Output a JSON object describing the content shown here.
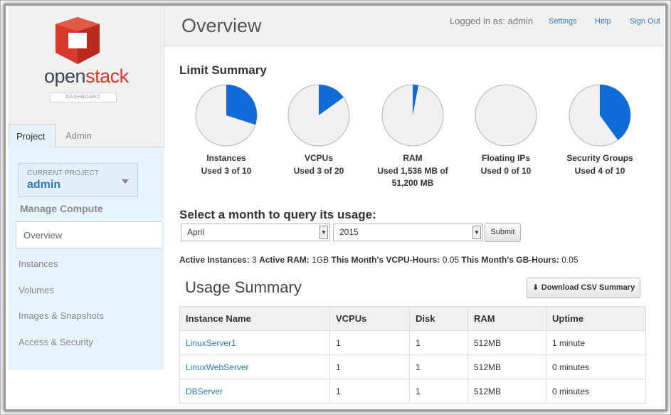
{
  "brand": {
    "word_open": "open",
    "word_stack": "stack",
    "badge": "DASHBOARD"
  },
  "colors": {
    "accent": "#2b7bb9",
    "pie_fill": "#0e6bd8",
    "pie_bg": "#f1f1f1",
    "logo_red": "#d53a2b"
  },
  "sidebar": {
    "tabs": [
      {
        "label": "Project"
      },
      {
        "label": "Admin"
      }
    ],
    "project_caption": "CURRENT PROJECT",
    "project_name": "admin",
    "section_heading": "Manage Compute",
    "items": [
      {
        "label": "Overview"
      },
      {
        "label": "Instances"
      },
      {
        "label": "Volumes"
      },
      {
        "label": "Images & Snapshots"
      },
      {
        "label": "Access & Security"
      }
    ]
  },
  "header": {
    "title": "Overview",
    "logged_in": "Logged in as: admin",
    "links": [
      {
        "label": "Settings"
      },
      {
        "label": "Help"
      },
      {
        "label": "Sign Out"
      }
    ]
  },
  "limit_summary": {
    "heading": "Limit Summary",
    "pies": [
      {
        "name": "Instances",
        "usage_line1": "Used 3 of 10",
        "usage_line2": "",
        "used": 3,
        "limit": 10
      },
      {
        "name": "VCPUs",
        "usage_line1": "Used 3 of 20",
        "usage_line2": "",
        "used": 3,
        "limit": 20
      },
      {
        "name": "RAM",
        "usage_line1": "Used 1,536 MB of",
        "usage_line2": "51,200 MB",
        "used": 1536,
        "limit": 51200
      },
      {
        "name": "Floating IPs",
        "usage_line1": "Used 0 of 10",
        "usage_line2": "",
        "used": 0,
        "limit": 10
      },
      {
        "name": "Security Groups",
        "usage_line1": "Used 4 of 10",
        "usage_line2": "",
        "used": 4,
        "limit": 10
      }
    ]
  },
  "query": {
    "label": "Select a month to query its usage:",
    "month_value": "April",
    "year_value": "2015",
    "submit_label": "Submit"
  },
  "stats": {
    "active_instances_label": "Active Instances:",
    "active_instances_value": "3",
    "active_ram_label": "Active RAM:",
    "active_ram_value": "1GB",
    "vcpu_hours_label": "This Month's VCPU-Hours:",
    "vcpu_hours_value": "0.05",
    "gb_hours_label": "This Month's GB-Hours:",
    "gb_hours_value": "0.05"
  },
  "usage": {
    "title": "Usage Summary",
    "download_label": "Download CSV Summary",
    "columns": [
      "Instance Name",
      "VCPUs",
      "Disk",
      "RAM",
      "Uptime"
    ],
    "rows": [
      [
        "LinuxServer1",
        "1",
        "1",
        "512MB",
        "1 minute"
      ],
      [
        "LinuxWebServer",
        "1",
        "1",
        "512MB",
        "0 minutes"
      ],
      [
        "DBServer",
        "1",
        "1",
        "512MB",
        "0 minutes"
      ]
    ]
  }
}
